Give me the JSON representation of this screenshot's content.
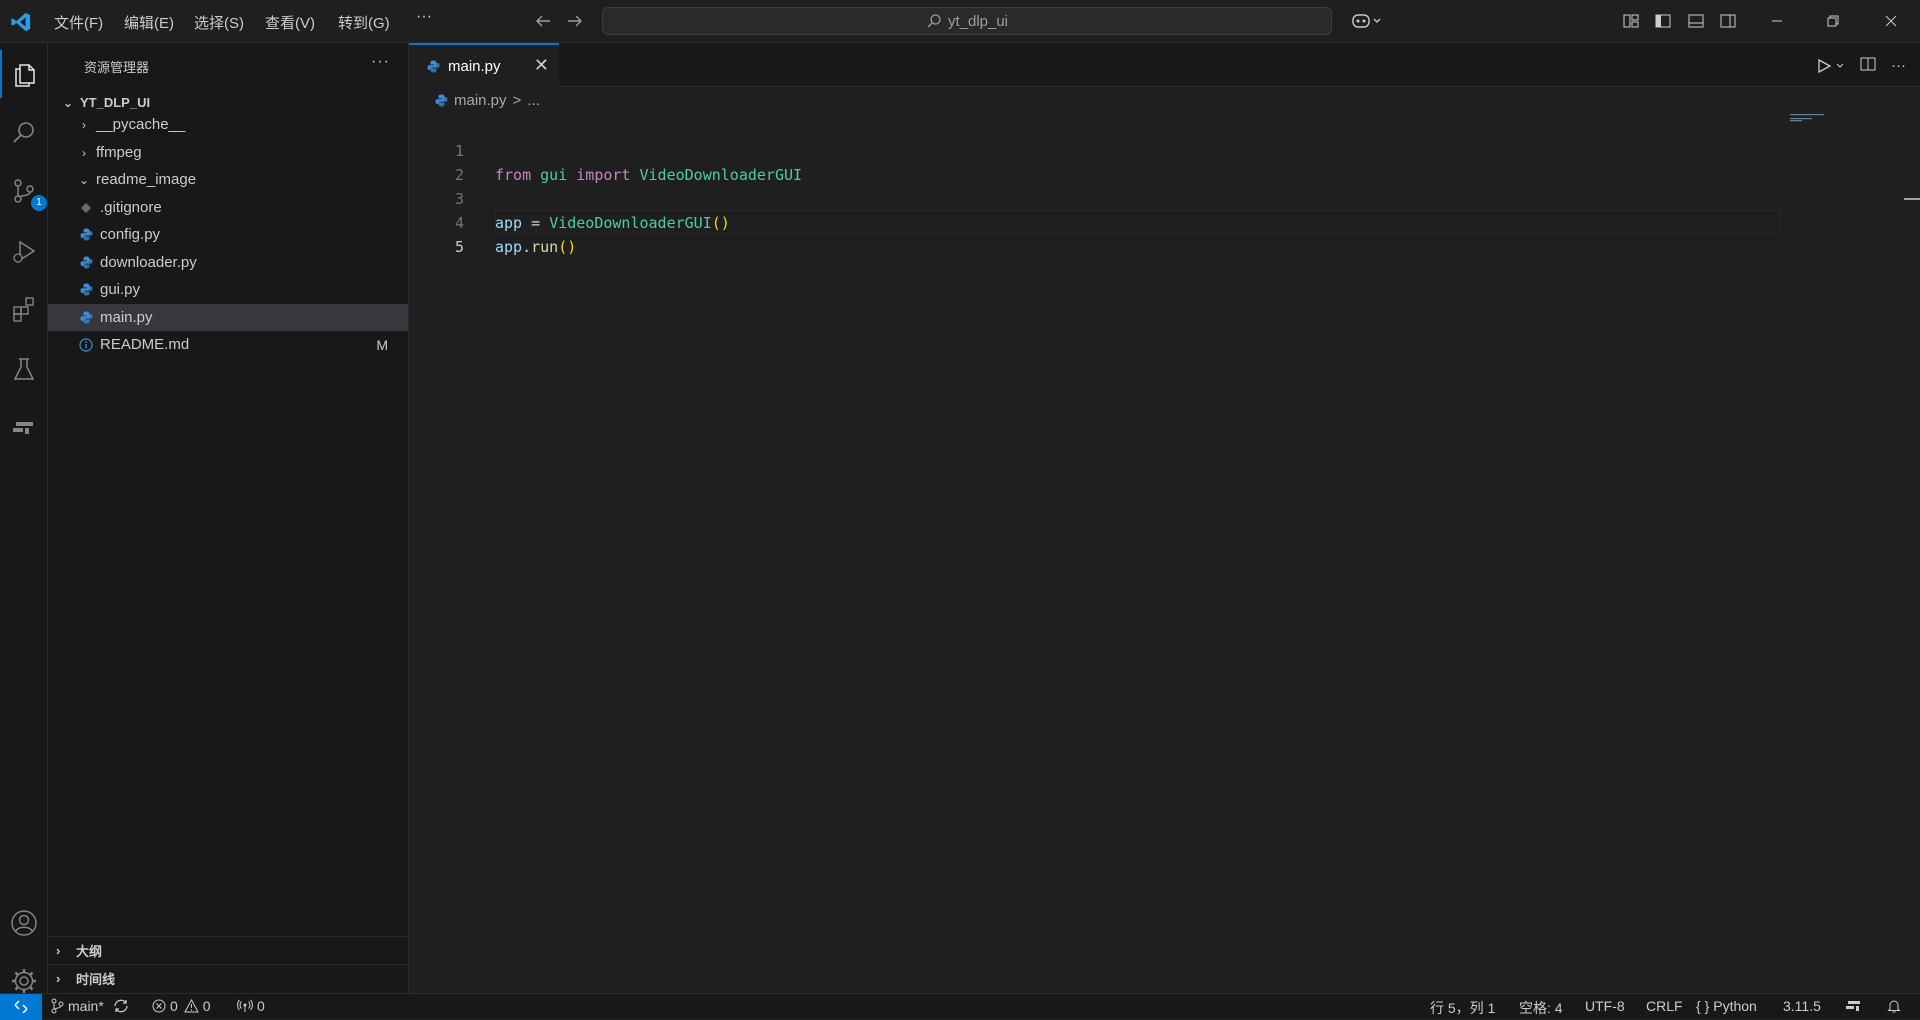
{
  "titlebar": {
    "menus": [
      "文件(F)",
      "编辑(E)",
      "选择(S)",
      "查看(V)",
      "转到(G)",
      "···"
    ],
    "search": "yt_dlp_ui"
  },
  "activity": {
    "scm_badge": "1"
  },
  "sidebar": {
    "title": "资源管理器",
    "more": "···",
    "root": "YT_DLP_UI",
    "items": [
      {
        "label": "__pycache__",
        "kind": "folder-collapsed"
      },
      {
        "label": "ffmpeg",
        "kind": "folder-collapsed"
      },
      {
        "label": "readme_image",
        "kind": "folder-expanded"
      },
      {
        "label": ".gitignore",
        "kind": "git-file"
      },
      {
        "label": "config.py",
        "kind": "python-file"
      },
      {
        "label": "downloader.py",
        "kind": "python-file"
      },
      {
        "label": "gui.py",
        "kind": "python-file"
      },
      {
        "label": "main.py",
        "kind": "python-file",
        "selected": true
      },
      {
        "label": "README.md",
        "kind": "info-file",
        "status": "M"
      }
    ],
    "outline": "大纲",
    "timeline": "时间线"
  },
  "editor": {
    "tab_label": "main.py",
    "close": "✕",
    "more": "···",
    "breadcrumb": {
      "file": "main.py",
      "sep": ">",
      "rest": "..."
    },
    "lines": [
      {
        "n": "1"
      },
      {
        "n": "2"
      },
      {
        "n": "3"
      },
      {
        "n": "4"
      },
      {
        "n": "5",
        "current": true
      }
    ],
    "code": {
      "l1": {
        "kw1": "from",
        "mod": "gui",
        "kw2": "import",
        "cls": "VideoDownloaderGUI"
      },
      "l3": {
        "var": "app",
        "op": "=",
        "cls": "VideoDownloaderGUI",
        "parens": "()"
      },
      "l4": {
        "var": "app",
        "dot": ".",
        "fn": "run",
        "parens": "()"
      }
    }
  },
  "statusbar": {
    "branch": "main*",
    "errors": "0",
    "warnings": "0",
    "ports": "0",
    "position": "行 5，列 1",
    "spaces": "空格: 4",
    "encoding": "UTF-8",
    "eol": "CRLF",
    "language_braces": "{ }",
    "language": "Python",
    "version": "3.11.5"
  },
  "colors": {
    "accent": "#0078d4",
    "python": "#3b8eda",
    "bg": "#1f1f1f",
    "sidebar": "#181818"
  }
}
